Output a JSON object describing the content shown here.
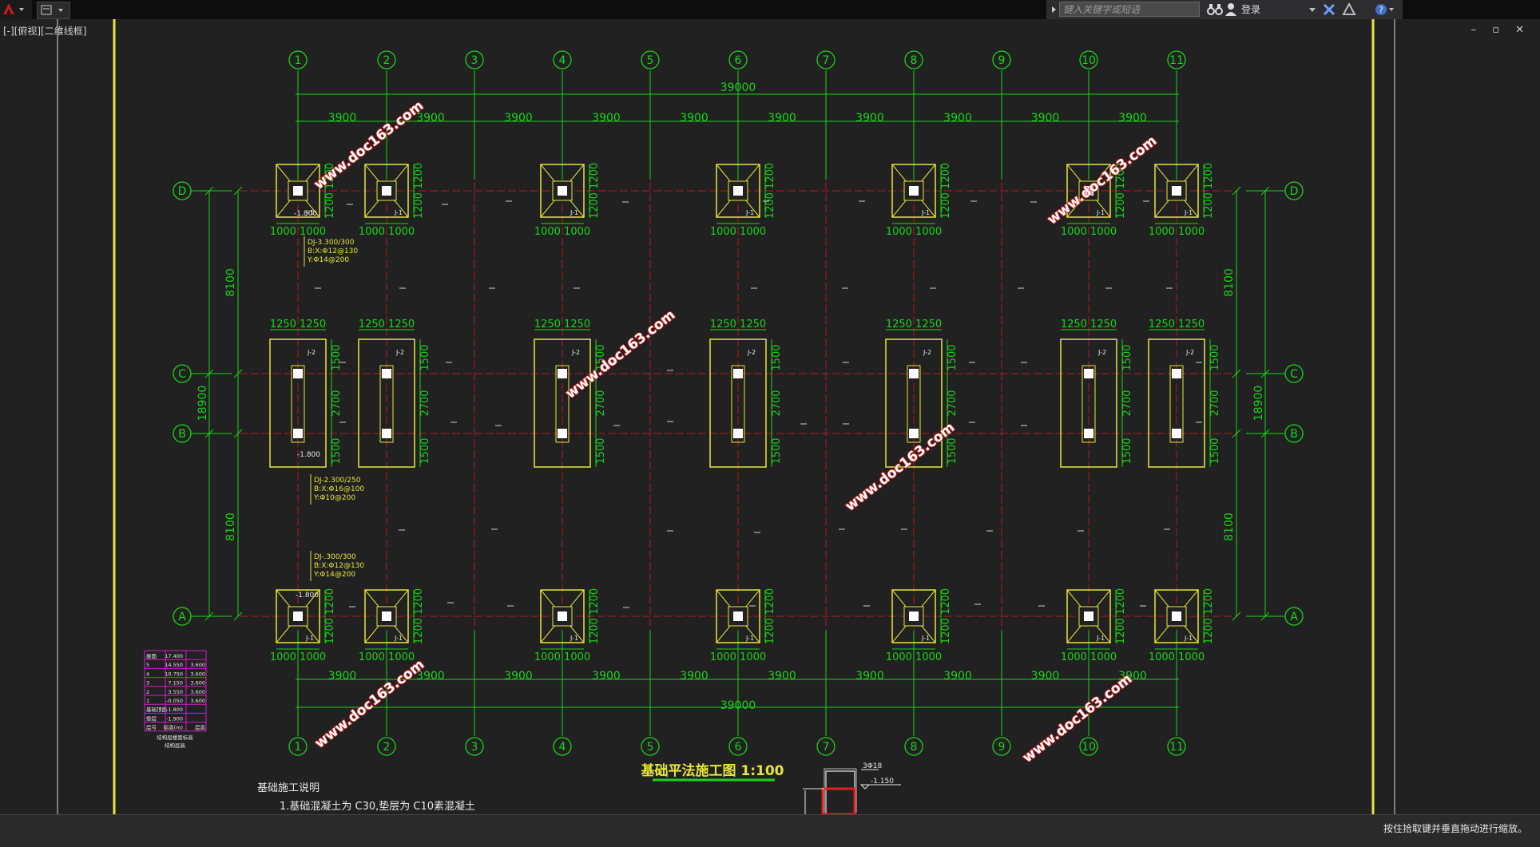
{
  "window": {
    "view_label": "[-][俯视][二维线框]",
    "search_placeholder": "键入关键字或短语",
    "login_label": "登录",
    "status_message": "按住拾取键并垂直拖动进行缩放。",
    "window_controls": "– ▫ ✕"
  },
  "drawing": {
    "title": "基础平法施工图 1:100",
    "notes_title": "基础施工说明",
    "notes_line1": "1.基础混凝土为 C30,垫层为 C10素混凝土",
    "watermark": "www.doc163.com",
    "column_axes": [
      "1",
      "2",
      "3",
      "4",
      "5",
      "6",
      "7",
      "8",
      "9",
      "10",
      "11"
    ],
    "row_axes": [
      "D",
      "C",
      "B",
      "A"
    ],
    "total_width": "39000",
    "bay_spacing": "3900",
    "spacings_top": [
      "3900",
      "3900",
      "3900",
      "3900",
      "3900",
      "3900",
      "3900",
      "3900",
      "3900",
      "3900"
    ],
    "total_depth": "18900",
    "side_dims": [
      "8100",
      "2700",
      "8100"
    ],
    "j1_dims": "1000 1000",
    "j1_depth": "1200 1200",
    "j2_dims": "1250 1250",
    "j2_rows": [
      "1500",
      "2700",
      "1500"
    ],
    "j1_label": "J-1",
    "j2_label": "J-2",
    "elev_neg": "-1.800",
    "dj1_spec": [
      "DJ-3.300/300",
      "B:X:Φ12@130",
      "Y:Φ14@200"
    ],
    "dj2_spec": [
      "DJ-2.300/250",
      "B:X:Φ16@100",
      "Y:Φ10@200"
    ],
    "dj3_spec": [
      "DJ-.300/300",
      "B:X:Φ12@130",
      "Y:Φ14@200"
    ],
    "section_bars": "3Φ18",
    "section_elev": "-1.150",
    "floor_table": {
      "rows": [
        [
          "屋面",
          "17.400",
          ""
        ],
        [
          "5",
          "14.550",
          "3.600"
        ],
        [
          "4",
          "10.750",
          "3.600"
        ],
        [
          "3",
          "7.150",
          "3.600"
        ],
        [
          "2",
          "3.550",
          "3.600"
        ],
        [
          "1",
          "-0.050",
          "3.600"
        ],
        [
          "基础顶面",
          "-1.800",
          ""
        ],
        [
          "垫层",
          "-1.900",
          ""
        ],
        [
          "层号",
          "标高(m)",
          "层高"
        ]
      ],
      "caption1": "结构层楼面标高",
      "caption2": "结构层高"
    }
  },
  "colors": {
    "green": "#19d419",
    "yellow": "#e6e63c",
    "red": "#b31c1c",
    "magenta": "#d31ad3",
    "bg": "#212121"
  }
}
